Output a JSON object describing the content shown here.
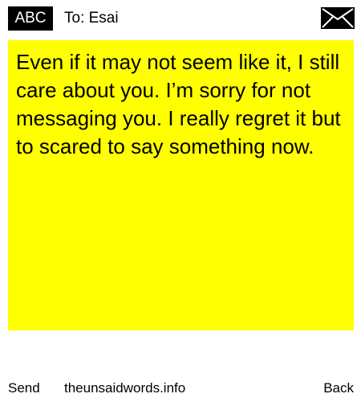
{
  "header": {
    "keyboard_mode_label": "ABC",
    "recipient_label": "To: Esai",
    "envelope_icon": "envelope-icon"
  },
  "message": {
    "text": "Even if it may not seem like it, I still care about you. I’m sorry for not messaging you. I really regret it but to scared to say something now.",
    "background_color": "#ffff00"
  },
  "footer": {
    "send_label": "Send",
    "site_label": "theunsaidwords.info",
    "back_label": "Back"
  }
}
